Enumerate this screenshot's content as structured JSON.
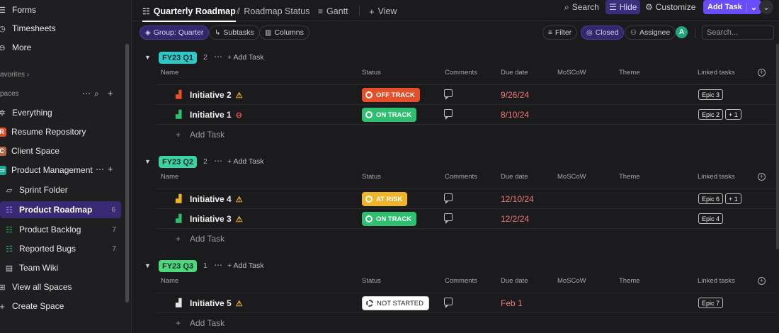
{
  "sidebar": {
    "items_top": [
      {
        "label": "Forms",
        "icon": "form-icon"
      },
      {
        "label": "Timesheets",
        "icon": "clock-icon"
      },
      {
        "label": "More",
        "icon": "more-circle-icon"
      }
    ],
    "favorites_label": "avorites",
    "spaces_label": "paces",
    "spaces": [
      {
        "label": "Everything",
        "icon": "sparkle-icon"
      },
      {
        "label": "Resume Repository",
        "avatar": "R",
        "color": "#e5502a"
      },
      {
        "label": "Client Space",
        "avatar": "C",
        "color": "#b46a4a"
      },
      {
        "label": "Product Management",
        "icon": "monitor-icon"
      }
    ],
    "folders": [
      {
        "label": "Sprint Folder",
        "icon": "folder-icon",
        "count": ""
      },
      {
        "label": "Product Roadmap",
        "icon": "list-icon",
        "count": "6",
        "active": true
      },
      {
        "label": "Product Backlog",
        "icon": "list-icon",
        "count": "7"
      },
      {
        "label": "Reported Bugs",
        "icon": "list-icon",
        "count": "7"
      },
      {
        "label": "Team Wiki",
        "icon": "doc-icon",
        "count": ""
      }
    ],
    "bottom": [
      {
        "label": "View all Spaces",
        "icon": "grid-icon"
      },
      {
        "label": "Create Space",
        "icon": "plus-icon"
      }
    ]
  },
  "topbar": {
    "tabs": [
      "Quarterly Roadmap",
      "Roadmap Status",
      "Gantt",
      "View"
    ],
    "search_label": "Search",
    "hide_label": "Hide",
    "customize_label": "Customize",
    "add_task_label": "Add Task"
  },
  "filters": {
    "group_label": "Group: Quarter",
    "subtasks_label": "Subtasks",
    "columns_label": "Columns",
    "filter_label": "Filter",
    "closed_label": "Closed",
    "assignee_label": "Assignee",
    "assignee_avatar": "A",
    "search_placeholder": "Search..."
  },
  "columns": {
    "name": "Name",
    "status": "Status",
    "comments": "Comments",
    "due_date": "Due date",
    "moscow": "MoSCoW",
    "theme": "Theme",
    "linked": "Linked tasks"
  },
  "groups": [
    {
      "label": "FY23 Q1",
      "color": "#2fc8c8",
      "count": "2",
      "add_task": "Add Task",
      "rows": [
        {
          "name": "Initiative 2",
          "flag_color": "#e5502a",
          "warn": "⚠",
          "warn_color": "#f0b429",
          "status": "OFF TRACK",
          "status_color": "#e5502a",
          "due": "9/26/24",
          "linked": [
            "Epic 3"
          ]
        },
        {
          "name": "Initiative 1",
          "flag_color": "#2fbf71",
          "warn": "⊖",
          "warn_color": "#e55353",
          "status": "ON TRACK",
          "status_color": "#2fbf71",
          "due": "8/10/24",
          "linked": [
            "Epic 2",
            "+ 1"
          ]
        }
      ],
      "add_row": "Add Task"
    },
    {
      "label": "FY23 Q2",
      "color": "#3bd3a0",
      "count": "2",
      "add_task": "Add Task",
      "rows": [
        {
          "name": "Initiative 4",
          "flag_color": "#f0b429",
          "warn": "⚠",
          "warn_color": "#f0b429",
          "status": "AT RISK",
          "status_color": "#f0b429",
          "due": "12/10/24",
          "linked": [
            "Epic 6",
            "+ 1"
          ]
        },
        {
          "name": "Initiative 3",
          "flag_color": "#2fbf71",
          "warn": "⚠",
          "warn_color": "#f0b429",
          "status": "ON TRACK",
          "status_color": "#2fbf71",
          "due": "12/2/24",
          "linked": [
            "Epic 4"
          ]
        }
      ],
      "add_row": "Add Task"
    },
    {
      "label": "FY23 Q3",
      "color": "#4cd97b",
      "count": "1",
      "add_task": "Add Task",
      "rows": [
        {
          "name": "Initiative 5",
          "flag_color": "#e6e6e6",
          "warn": "⚠",
          "warn_color": "#f0b429",
          "status": "NOT STARTED",
          "status_color": "#ffffff",
          "due": "Feb 1",
          "linked": [
            "Epic 7"
          ]
        }
      ],
      "add_row": "Add Task"
    }
  ]
}
